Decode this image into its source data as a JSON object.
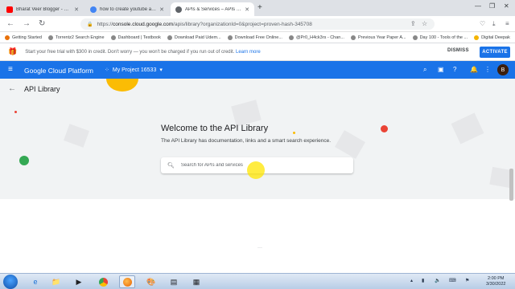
{
  "browser": {
    "tabs": [
      {
        "title": "Bharat Veer Blogger - YouTube",
        "favicon_color": "#ff0000",
        "active": false
      },
      {
        "title": "how to create youtube api key - ...",
        "favicon_color": "#4285f4",
        "active": false
      },
      {
        "title": "APIs & Services – APIs and serv...",
        "favicon_color": "#5f6368",
        "active": true
      }
    ],
    "new_tab": "+",
    "address": {
      "lock": "🔒",
      "prefix": "https://",
      "domain": "console.cloud.google.com",
      "path": "/apis/library?organizationId=0&project=proven-hash-345708"
    },
    "bookmarks": [
      "Getting Started",
      "Torrentz2 Search Engine",
      "Dashboard | Testbook",
      "Download Paid Udem...",
      "Download Free Online...",
      "@Pr0_H4ck3rs - Chan...",
      "Previous Year Paper A...",
      "Day 100 - Tools of the ...",
      "Digital Deepak"
    ]
  },
  "banner": {
    "text": "Start your free trial with $300 in credit. Don't worry — you won't be charged if you run out of credit.",
    "link": "Learn more",
    "dismiss": "DISMISS",
    "activate": "ACTIVATE"
  },
  "header": {
    "brand": "Google Cloud Platform",
    "project": "My Project 16533",
    "avatar": "B",
    "color": "#1a73e8"
  },
  "page": {
    "title": "API Library",
    "welcome": "Welcome to the API Library",
    "subtitle": "The API Library has documentation, links and a smart search experience.",
    "search_placeholder": "Search for APIs and services"
  },
  "taskbar": {
    "time": "2:00 PM",
    "date": "3/30/2022"
  }
}
